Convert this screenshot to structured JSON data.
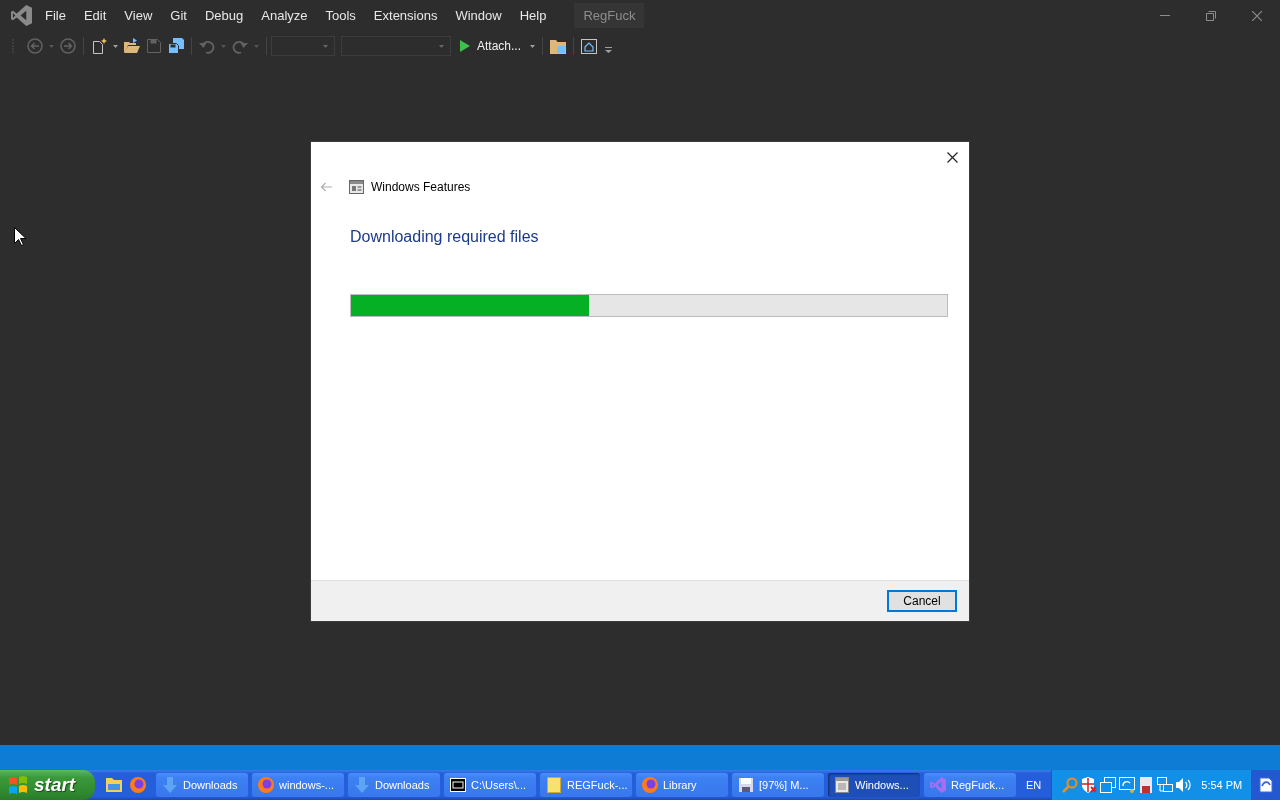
{
  "window": {
    "menu": [
      "File",
      "Edit",
      "View",
      "Git",
      "Debug",
      "Analyze",
      "Tools",
      "Extensions",
      "Window",
      "Help"
    ],
    "solution_name": "RegFuck"
  },
  "toolbar": {
    "buttons": [
      {
        "disabled": true
      },
      {
        "disabled": true
      },
      {
        "disabled": false
      },
      {
        "disabled": false
      },
      {
        "disabled": true
      },
      {
        "disabled": false
      },
      {
        "disabled": true
      },
      {
        "disabled": true
      }
    ],
    "combos": [
      {
        "disabled": true
      },
      {
        "disabled": true
      }
    ],
    "start_button": {
      "label": "Attach..."
    },
    "tool_buttons": [
      {
        "disabled": false
      },
      {
        "disabled": false
      }
    ]
  },
  "dialog": {
    "back_button": {
      "disabled": true
    },
    "title": "Windows Features",
    "heading": "Downloading required files",
    "progress": {
      "level": 0.4
    },
    "buttons": [
      {
        "label": "Cancel",
        "focused": true
      }
    ]
  },
  "taskbar": {
    "start": "start",
    "buttons": [
      {
        "label": "Downloads",
        "selected": false
      },
      {
        "label": "windows-...",
        "selected": false
      },
      {
        "label": "Downloads",
        "selected": false
      },
      {
        "label": "C:\\Users\\...",
        "selected": false
      },
      {
        "label": "REGFuck-...",
        "selected": false
      },
      {
        "label": "Library",
        "selected": false
      },
      {
        "label": "[97%] M...",
        "selected": false
      },
      {
        "label": "Windows...",
        "selected": true
      },
      {
        "label": "RegFuck...",
        "selected": false
      }
    ],
    "language": "EN",
    "clock": "5:54 PM"
  }
}
